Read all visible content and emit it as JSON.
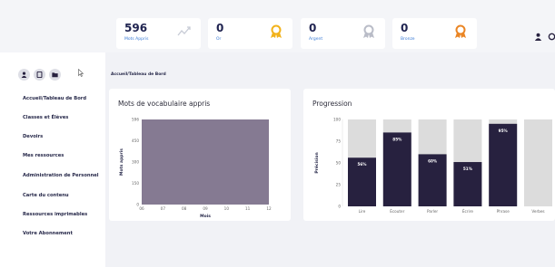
{
  "stats": [
    {
      "value": "596",
      "label": "Mots Appris",
      "icon": "trend-line-icon",
      "icon_color": "#c8ccd6"
    },
    {
      "value": "0",
      "label": "Or",
      "icon": "gold-medal-icon",
      "icon_color": "#f2b21a"
    },
    {
      "value": "0",
      "label": "Argent",
      "icon": "silver-medal-icon",
      "icon_color": "#b9bcc7"
    },
    {
      "value": "0",
      "label": "Bronze",
      "icon": "bronze-medal-icon",
      "icon_color": "#ea8524"
    }
  ],
  "sidebar": {
    "items": [
      {
        "label": "Accueil/Tableau de Bord"
      },
      {
        "label": "Classes et Élèves"
      },
      {
        "label": "Devoirs"
      },
      {
        "label": "Mes ressources"
      },
      {
        "label": "Administration de Personnel"
      },
      {
        "label": "Carte du contenu"
      },
      {
        "label": "Ressources imprimables"
      },
      {
        "label": "Votre Abonnement"
      }
    ]
  },
  "breadcrumb": "Accueil/Tableau de Bord",
  "vocab_panel": {
    "title": "Mots de vocabulaire appris"
  },
  "progress_panel": {
    "title": "Progression"
  },
  "colors": {
    "accent": "#27213f",
    "vocab_area": "#857a92",
    "bar_background": "#dcdcdc",
    "stat_label": "#3a7bd5"
  },
  "chart_data": [
    {
      "type": "area",
      "title": "Mots de vocabulaire appris",
      "xlabel": "Mois",
      "ylabel": "Mots appris",
      "x": [
        "06",
        "07",
        "08",
        "09",
        "10",
        "11",
        "12"
      ],
      "y": [
        596,
        596,
        596,
        596,
        596,
        596,
        596
      ],
      "ylim": [
        0,
        596
      ],
      "yticks": [
        "0",
        "150",
        "300",
        "450",
        "596"
      ]
    },
    {
      "type": "bar",
      "title": "Progression",
      "ylabel": "Précision",
      "categories": [
        "Lire",
        "Écouter",
        "Parler",
        "Écrire",
        "Phrase",
        "Verbes"
      ],
      "values": [
        56,
        85,
        60,
        51,
        95,
        0
      ],
      "value_labels": [
        "56%",
        "85%",
        "60%",
        "51%",
        "95%",
        ""
      ],
      "ylim": [
        0,
        100
      ],
      "yticks": [
        "0",
        "25",
        "50",
        "75",
        "100"
      ]
    }
  ]
}
